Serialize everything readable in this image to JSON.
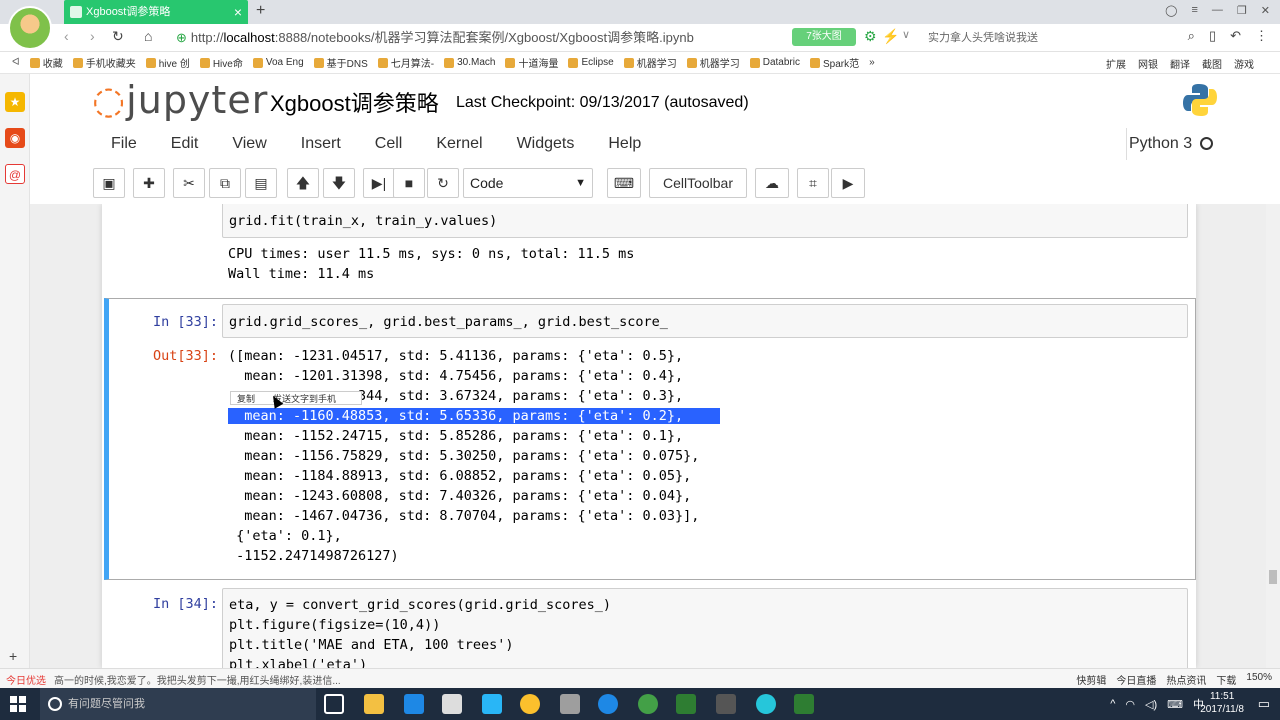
{
  "browser": {
    "tab_title": "Xgboost调参策略",
    "url_scheme": "http://",
    "url_host": "localhost",
    "url_rest": ":8888/notebooks/机器学习算法配套案例/Xgboost/Xgboost调参策略.ipynb",
    "ext_label": "7张大图",
    "search_hint": "实力拿人头凭啥说我送",
    "bookmarks": [
      "收藏",
      "手机收藏夹",
      "hive 创",
      "Hive命",
      "Voa Eng",
      "基于DNS",
      "七月算法-",
      "30.Mach",
      "十道海量",
      "Eclipse",
      "机器学习",
      "机器学习",
      "Databric",
      "Spark范"
    ],
    "bookmarks_more": "»",
    "bookmarks_right": [
      "扩展",
      "网银",
      "翻译",
      "截图",
      "游戏"
    ]
  },
  "jupyter": {
    "logo_text": "jupyter",
    "notebook_title": "Xgboost调参策略",
    "checkpoint": "Last Checkpoint: 09/13/2017 (autosaved)",
    "menu": [
      "File",
      "Edit",
      "View",
      "Insert",
      "Cell",
      "Kernel",
      "Widgets",
      "Help"
    ],
    "kernel": "Python 3",
    "cell_type": "Code",
    "celltoolbar_label": "CellToolbar"
  },
  "cells": {
    "prev_code": "grid.fit(train_x, train_y.values)",
    "prev_output": [
      "CPU times: user 11.5 ms, sys: 0 ns, total: 11.5 ms",
      "Wall time: 11.4 ms"
    ],
    "c33_prompt": "In [33]:",
    "c33_code": "grid.grid_scores_, grid.best_params_, grid.best_score_",
    "c33_out_prompt": "Out[33]:",
    "c33_out": [
      "([mean: -1231.04517, std: 5.41136, params: {'eta': 0.5},",
      "  mean: -1201.31398, std: 4.75456, params: {'eta': 0.4},",
      "                344, std: 3.67324, params: {'eta': 0.3},",
      "  mean: -1160.48853, std: 5.65336, params: {'eta': 0.2},",
      "  mean: -1152.24715, std: 5.85286, params: {'eta': 0.1},",
      "  mean: -1156.75829, std: 5.30250, params: {'eta': 0.075},",
      "  mean: -1184.88913, std: 6.08852, params: {'eta': 0.05},",
      "  mean: -1243.60808, std: 7.40326, params: {'eta': 0.04},",
      "  mean: -1467.04736, std: 8.70704, params: {'eta': 0.03}],",
      " {'eta': 0.1},",
      " -1152.2471498726127)"
    ],
    "ctx_copy": "复制",
    "ctx_send": "发送文字到手机",
    "c34_prompt": "In [34]:",
    "c34_code": [
      "eta, y = convert_grid_scores(grid.grid_scores_)",
      "plt.figure(figsize=(10,4))",
      "plt.title('MAE and ETA, 100 trees')",
      "plt.xlabel('eta')"
    ]
  },
  "statusbar": {
    "left": [
      "今日优选",
      "高一的时候,我恋爱了。我把头发剪下一撮,用红头绳绑好,装进信..."
    ],
    "right": [
      "快剪辑",
      "今日直播",
      "热点资讯",
      "下载",
      "150%"
    ]
  },
  "taskbar": {
    "search_placeholder": "有问题尽管问我",
    "ime": "中",
    "time": "11:51",
    "date": "2017/11/8"
  }
}
